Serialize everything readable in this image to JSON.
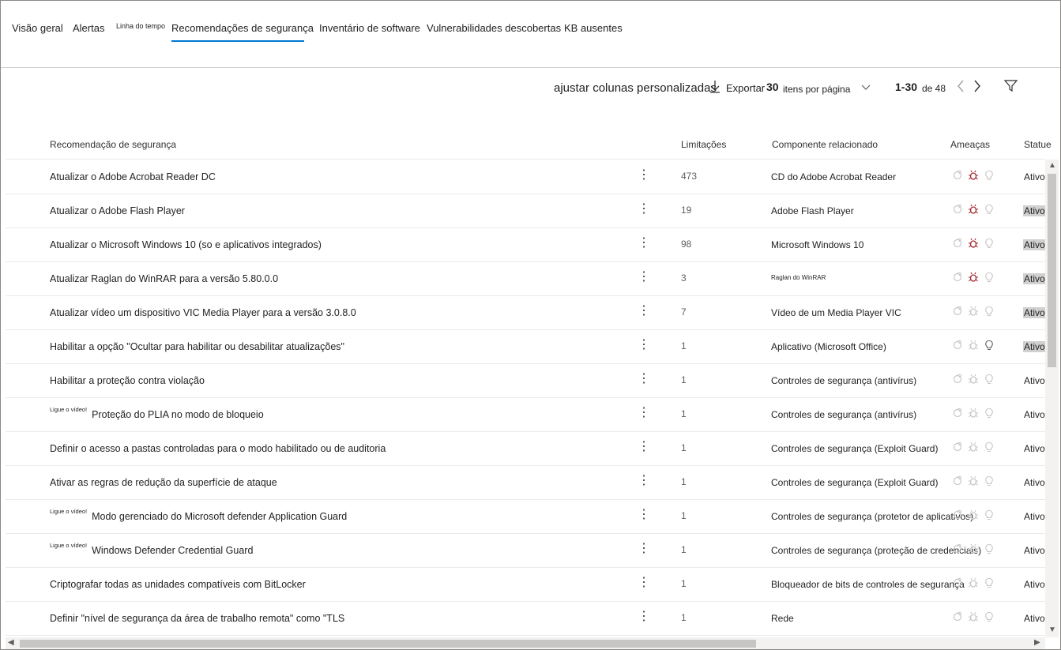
{
  "tabs": [
    {
      "label": "Visão geral"
    },
    {
      "label": "Alertas"
    },
    {
      "label": "Linha do tempo"
    },
    {
      "label": "Recomendações de segurança"
    },
    {
      "label": "Inventário de software"
    },
    {
      "label": "Vulnerabilidades descobertas"
    },
    {
      "label": "KB ausentes"
    }
  ],
  "toolbar": {
    "customize": "ajustar colunas personalizadas",
    "export": "Exportar",
    "per_page_count": "30",
    "per_page_label": "itens por página",
    "range": "1-30",
    "of": "de 48"
  },
  "columns": {
    "recommendation": "Recomendação de segurança",
    "limitations": "Limitações",
    "component": "Componente relacionado",
    "threats": "Ameaças",
    "status": "Statue"
  },
  "rows": [
    {
      "tag": "",
      "name": "Atualizar o Adobe Acrobat Reader DC",
      "lim": "473",
      "comp": "CD do Adobe Acrobat Reader",
      "status": "Ativo"
    },
    {
      "tag": "",
      "name": "Atualizar o Adobe Flash Player",
      "lim": "19",
      "comp": "Adobe Flash Player",
      "status": "Ativo"
    },
    {
      "tag": "",
      "name": "Atualizar o Microsoft Windows 10 (so e aplicativos integrados)",
      "lim": "98",
      "comp": "Microsoft Windows 10",
      "status": "Ativo"
    },
    {
      "tag": "",
      "name": "Atualizar Raglan do WinRAR para a versão 5.80.0.0",
      "lim": "3",
      "comp": "Raglan do WinRAR",
      "status": "Ativo"
    },
    {
      "tag": "",
      "name": "Atualizar vídeo um dispositivo VIC Media Player para a versão 3.0.8.0",
      "lim": "7",
      "comp": "Vídeo de um Media Player VIC",
      "status": "Ativo"
    },
    {
      "tag": "",
      "name": "Habilitar a opção \"Ocultar para habilitar ou desabilitar atualizações\"",
      "lim": "1",
      "comp": "Aplicativo (Microsoft Office)",
      "status": "Ativo"
    },
    {
      "tag": "",
      "name": "Habilitar a proteção contra violação",
      "lim": "1",
      "comp": "Controles de segurança (antivírus)",
      "status": "Ativo"
    },
    {
      "tag": "Ligue o vídeo!",
      "name": "Proteção do PLIA no modo de bloqueio",
      "lim": "1",
      "comp": "Controles de segurança (antivírus)",
      "status": "Ativo"
    },
    {
      "tag": "",
      "name": "Definir o acesso a pastas controladas para o modo habilitado ou de auditoria",
      "lim": "1",
      "comp": "Controles de segurança (Exploit Guard)",
      "status": "Ativo"
    },
    {
      "tag": "",
      "name": "Ativar as regras de redução da superfície de ataque",
      "lim": "1",
      "comp": "Controles de segurança (Exploit Guard)",
      "status": "Ativo"
    },
    {
      "tag": "Ligue o vídeo!",
      "name": "Modo gerenciado do Microsoft defender Application Guard",
      "lim": "1",
      "comp": "Controles de segurança (protetor de aplicativos)",
      "status": "Ativo"
    },
    {
      "tag": "Ligue o vídeo!",
      "name": "Windows Defender Credential Guard",
      "lim": "1",
      "comp": "Controles de segurança (proteção de credenciais)",
      "status": "Ativo"
    },
    {
      "tag": "",
      "name": "Criptografar todas as unidades compatíveis com BitLocker",
      "lim": "1",
      "comp": "Bloqueador de bits de controles de segurança",
      "status": "Ativo"
    },
    {
      "tag": "",
      "name": "Definir \"nível de segurança da área de trabalho remota\" como \"TLS",
      "lim": "1",
      "comp": "Rede",
      "status": "Ativo"
    }
  ],
  "threat_icons": [
    "exploit-icon",
    "bug-icon",
    "lightbulb-icon"
  ],
  "colors": {
    "accent": "#0078d4",
    "threat_active": "#a4262c",
    "threat_inactive": "#c8c6c4",
    "highlight": "#d0d0d0"
  }
}
